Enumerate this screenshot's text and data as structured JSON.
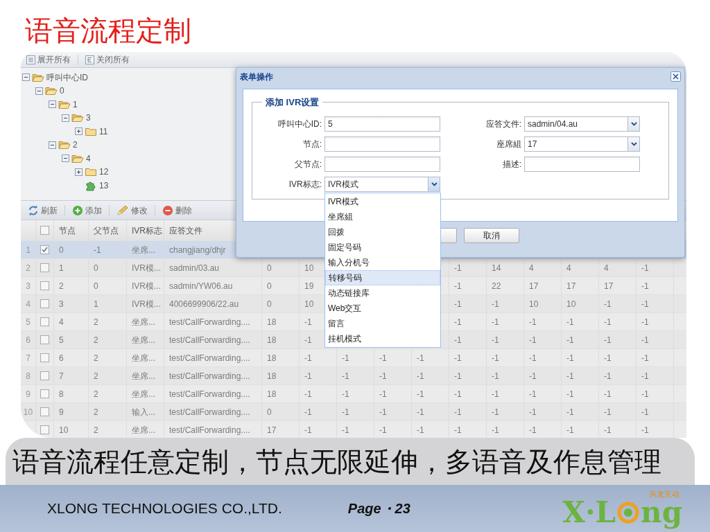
{
  "slide_title": "语音流程定制",
  "tree_toolbar": [
    {
      "label": "展开所有",
      "kind": "expand_all"
    },
    {
      "label": "关闭所有",
      "kind": "collapse_all"
    }
  ],
  "tree": [
    {
      "label": "呼叫中心ID",
      "kind": "folder",
      "expanded": true,
      "children": [
        {
          "label": "0",
          "kind": "folder",
          "expanded": true,
          "children": [
            {
              "label": "1",
              "kind": "folder",
              "expanded": true,
              "children": [
                {
                  "label": "3",
                  "kind": "folder",
                  "expanded": true,
                  "children": [
                    {
                      "label": "11",
                      "kind": "folder",
                      "expanded": false
                    }
                  ]
                }
              ]
            },
            {
              "label": "2",
              "kind": "folder",
              "expanded": true,
              "children": [
                {
                  "label": "4",
                  "kind": "folder",
                  "expanded": true,
                  "children": [
                    {
                      "label": "12",
                      "kind": "folder",
                      "expanded": false
                    },
                    {
                      "label": "13",
                      "kind": "leaf"
                    }
                  ]
                }
              ]
            }
          ]
        }
      ]
    }
  ],
  "grid_toolbar": [
    {
      "label": "刷新",
      "kind": "refresh"
    },
    {
      "label": "添加",
      "kind": "add"
    },
    {
      "label": "修改",
      "kind": "edit"
    },
    {
      "label": "删除",
      "kind": "delete"
    }
  ],
  "table": {
    "header_checked": false,
    "columns": [
      "节点",
      "父节点",
      "IVR标志",
      "应答文件"
    ],
    "rows": [
      {
        "number": "1",
        "checked": true,
        "selected": true,
        "cells": [
          "0",
          "-1",
          "坐席...",
          "changjiang/dhjr"
        ]
      },
      {
        "number": "2",
        "checked": false,
        "selected": false,
        "cells": [
          "1",
          "0",
          "IVR模...",
          "sadmin/03.au",
          "0",
          "10",
          null,
          null,
          null,
          "-1",
          "14",
          "4",
          "4",
          "4",
          "-1"
        ]
      },
      {
        "number": "3",
        "checked": false,
        "selected": false,
        "cells": [
          "2",
          "0",
          "IVR模...",
          "sadmin/YW06.au",
          "0",
          "19",
          null,
          null,
          null,
          "-1",
          "22",
          "17",
          "17",
          "17",
          "-1"
        ]
      },
      {
        "number": "4",
        "checked": false,
        "selected": false,
        "cells": [
          "3",
          "1",
          "IVR模...",
          "4006699906/22.au",
          "0",
          "10",
          null,
          null,
          null,
          "-1",
          "-1",
          "10",
          "10",
          "-1",
          "-1"
        ]
      },
      {
        "number": "5",
        "checked": false,
        "selected": false,
        "cells": [
          "4",
          "2",
          "坐席...",
          "test/CallForwarding....",
          "18",
          "-1",
          null,
          null,
          null,
          "-1",
          "-1",
          "-1",
          "-1",
          "-1",
          "-1"
        ]
      },
      {
        "number": "6",
        "checked": false,
        "selected": false,
        "cells": [
          "5",
          "2",
          "坐席...",
          "test/CallForwarding....",
          "18",
          "-1",
          null,
          null,
          null,
          "-1",
          "-1",
          "-1",
          "-1",
          "-1",
          "-1"
        ]
      },
      {
        "number": "7",
        "checked": false,
        "selected": false,
        "cells": [
          "6",
          "2",
          "坐席...",
          "test/CallForwarding....",
          "18",
          "-1",
          "-1",
          "-1",
          "-1",
          "-1",
          "-1",
          "-1",
          "-1",
          "-1",
          "-1"
        ]
      },
      {
        "number": "8",
        "checked": false,
        "selected": false,
        "cells": [
          "7",
          "2",
          "坐席...",
          "test/CallForwarding....",
          "18",
          "-1",
          "-1",
          "-1",
          "-1",
          "-1",
          "-1",
          "-1",
          "-1",
          "-1",
          "-1"
        ]
      },
      {
        "number": "9",
        "checked": false,
        "selected": false,
        "cells": [
          "8",
          "2",
          "坐席...",
          "test/CallForwarding....",
          "18",
          "-1",
          "-1",
          "-1",
          "-1",
          "-1",
          "-1",
          "-1",
          "-1",
          "-1",
          "-1"
        ]
      },
      {
        "number": "10",
        "checked": false,
        "selected": false,
        "cells": [
          "9",
          "2",
          "输入...",
          "test/CallForwarding....",
          "0",
          "-1",
          "-1",
          "-1",
          "-1",
          "-1",
          "-1",
          "-1",
          "-1",
          "-1",
          "-1"
        ]
      },
      {
        "checked": false,
        "selected": false,
        "cells": [
          "10",
          "2",
          "坐席...",
          "test/CallForwarding....",
          "17",
          "-1",
          "-1",
          "-1",
          "-1",
          "-1",
          "-1",
          "-1",
          "-1",
          "-1",
          "-1"
        ]
      }
    ]
  },
  "dialog": {
    "title": "表单操作",
    "legend": "添加 IVR设置",
    "fields": [
      {
        "label": "呼叫中心ID:",
        "kind": "text",
        "value": "5"
      },
      {
        "label": "应答文件:",
        "kind": "combo",
        "value": "sadmin/04.au",
        "open": false
      },
      {
        "label": "节点:",
        "kind": "text"
      },
      {
        "label": "座席組",
        "kind": "combo",
        "value": "17",
        "open": false
      },
      {
        "label": "父节点:",
        "kind": "text"
      },
      {
        "label": "描述:",
        "kind": "text"
      },
      {
        "label": "IVR标志:",
        "kind": "combo",
        "value": "IVR模式",
        "open": true,
        "options": [
          {
            "label": "IVR模式",
            "highlighted": false
          },
          {
            "label": "坐席組",
            "highlighted": false
          },
          {
            "label": "回拨",
            "highlighted": false
          },
          {
            "label": "固定号码",
            "highlighted": false
          },
          {
            "label": "输入分机号",
            "highlighted": false
          },
          {
            "label": "转移号码",
            "highlighted": true
          },
          {
            "label": "动态链接库",
            "highlighted": false
          },
          {
            "label": "Web交互",
            "highlighted": false
          },
          {
            "label": "留言",
            "highlighted": false
          },
          {
            "label": "挂机模式",
            "highlighted": false
          }
        ]
      }
    ],
    "buttons": [
      "取消"
    ]
  },
  "caption": "语音流程任意定制，节点无限延伸，多语音及作息管理",
  "footer": {
    "company": "XLONG TECHNOLOGIES CO.,LTD.",
    "page": "Page・23",
    "logo": {
      "text_before": "X·L",
      "text_after": "ng",
      "tagline": "兴龙互动"
    }
  }
}
